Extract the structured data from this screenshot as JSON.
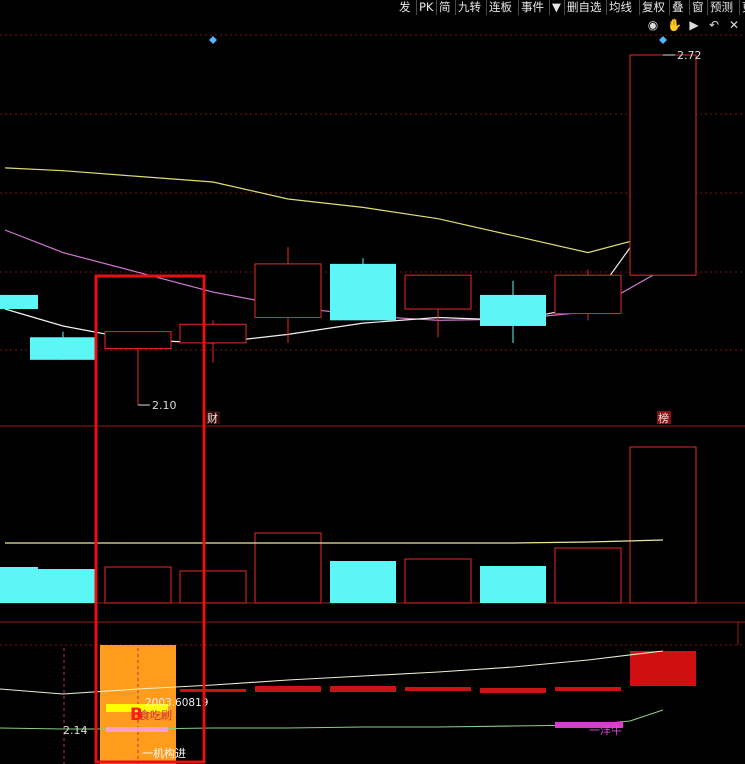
{
  "toolbar": {
    "items": [
      "发",
      "PK",
      "简",
      "九转",
      "连板",
      "事件",
      "▼",
      "删自选",
      "均线",
      "复权",
      "叠",
      "窗",
      "预测",
      "更"
    ],
    "icons": [
      "eye-icon",
      "hand-icon",
      "play-icon",
      "undo-icon",
      "close-icon"
    ]
  },
  "chart_data": {
    "type": "candlestick",
    "price": {
      "max_label": "2.72",
      "min_label": "2.10",
      "candles": [
        {
          "o": 2.295,
          "h": 2.295,
          "l": 2.27,
          "c": 2.27,
          "color": "cyan"
        },
        {
          "o": 2.22,
          "h": 2.23,
          "l": 2.18,
          "c": 2.18,
          "color": "cyan"
        },
        {
          "o": 2.2,
          "h": 2.23,
          "l": 2.1,
          "c": 2.23,
          "color": "red"
        },
        {
          "o": 2.21,
          "h": 2.25,
          "l": 2.175,
          "c": 2.243,
          "color": "red"
        },
        {
          "o": 2.255,
          "h": 2.38,
          "l": 2.21,
          "c": 2.35,
          "color": "red"
        },
        {
          "o": 2.35,
          "h": 2.36,
          "l": 2.25,
          "c": 2.25,
          "color": "cyan"
        },
        {
          "o": 2.27,
          "h": 2.32,
          "l": 2.22,
          "c": 2.33,
          "color": "red"
        },
        {
          "o": 2.295,
          "h": 2.32,
          "l": 2.21,
          "c": 2.24,
          "color": "cyan"
        },
        {
          "o": 2.262,
          "h": 2.34,
          "l": 2.25,
          "c": 2.33,
          "color": "red"
        },
        {
          "o": 2.33,
          "h": 2.72,
          "l": 2.33,
          "c": 2.72,
          "color": "red"
        }
      ],
      "ma_yellow": [
        2.52,
        2.515,
        2.505,
        2.495,
        2.465,
        2.45,
        2.43,
        2.4,
        2.37,
        2.405
      ],
      "ma_magenta": [
        2.41,
        2.37,
        2.335,
        2.3,
        2.275,
        2.258,
        2.25,
        2.252,
        2.265,
        2.34
      ],
      "ma_white": [
        2.27,
        2.24,
        2.215,
        2.21,
        2.225,
        2.245,
        2.255,
        2.25,
        2.275,
        2.46
      ],
      "markers": [
        "财",
        "榜"
      ]
    },
    "volume": {
      "values": [
        36,
        34,
        36,
        32,
        70,
        42,
        44,
        37,
        55,
        156
      ],
      "colors": [
        "cyan",
        "cyan",
        "red",
        "red",
        "red",
        "cyan",
        "red",
        "cyan",
        "red",
        "red"
      ],
      "ma": [
        60,
        60,
        60,
        60,
        60,
        60,
        60,
        60,
        61,
        63
      ]
    },
    "indicator": {
      "labels": [
        "2.14",
        "2003.60819",
        "食吃刷",
        "一机构进",
        "一洋牛"
      ],
      "signal_letter": "B"
    }
  }
}
